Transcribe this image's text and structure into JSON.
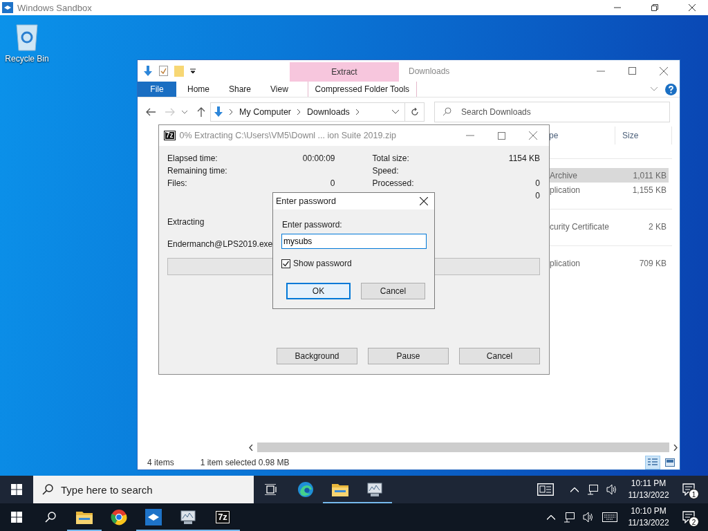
{
  "sandbox": {
    "title": "Windows Sandbox"
  },
  "desktop_icons": [
    {
      "label": "Recycle Bin"
    }
  ],
  "explorer": {
    "title": "Downloads",
    "context_group": "Extract",
    "ribbon_tabs": [
      {
        "label": "File",
        "kind": "file"
      },
      {
        "label": "Home",
        "kind": "tab"
      },
      {
        "label": "Share",
        "kind": "tab"
      },
      {
        "label": "View",
        "kind": "tab"
      },
      {
        "label": "Compressed Folder Tools",
        "kind": "context"
      }
    ],
    "breadcrumb": [
      "My Computer",
      "Downloads"
    ],
    "search": {
      "placeholder": "Search Downloads"
    },
    "columns": [
      "pe",
      "Size"
    ],
    "rows": [
      {
        "type": "Archive",
        "size": "1,011 KB",
        "selected": true
      },
      {
        "type": "plication",
        "size": "1,155 KB",
        "selected": false
      },
      {
        "type": "curity Certificate",
        "size": "2 KB",
        "selected": false
      },
      {
        "type": "plication",
        "size": "709 KB",
        "selected": false
      }
    ],
    "status": {
      "count": "4 items",
      "selection": "1 item selected  0.98 MB"
    }
  },
  "extract_window": {
    "app_icon": "7z",
    "title": "0% Extracting C:\\Users\\VM5\\Downl ... ion Suite 2019.zip",
    "stats_left": [
      {
        "label": "Elapsed time:",
        "value": "00:00:09"
      },
      {
        "label": "Remaining time:"
      },
      {
        "label": "Files:",
        "value": "0"
      }
    ],
    "stats_right": [
      {
        "label": "Total size:",
        "value": "1154 KB"
      },
      {
        "label": "Speed:"
      },
      {
        "label": "Processed:",
        "value": "0"
      },
      {
        "value": "0"
      }
    ],
    "operation": "Extracting",
    "current_file": "Endermanch@LPS2019.exe",
    "progress": {
      "level": 0
    },
    "buttons": [
      "Background",
      "Pause",
      "Cancel"
    ]
  },
  "password_dialog": {
    "title": "Enter password",
    "label": "Enter password:",
    "value": "mysubs",
    "show_password": {
      "label": "Show password",
      "checked": true
    },
    "buttons": [
      {
        "label": "OK",
        "default": true
      },
      {
        "label": "Cancel",
        "default": false
      }
    ]
  },
  "taskbars": [
    {
      "search": {
        "placeholder": "Type here to search"
      },
      "apps": [
        {
          "kind": "taskview",
          "active": false
        },
        {
          "kind": "edge",
          "active": false
        },
        {
          "kind": "folder",
          "active": true
        },
        {
          "kind": "monitor",
          "active": true
        }
      ],
      "tray": [
        {
          "kind": "news"
        },
        {
          "kind": "caret"
        },
        {
          "kind": "network"
        },
        {
          "kind": "volume"
        }
      ],
      "time": "10:11 PM",
      "date": "11/13/2022",
      "notifications": "1"
    },
    {
      "apps": [
        {
          "kind": "search",
          "active": false
        },
        {
          "kind": "folder",
          "active": true
        },
        {
          "kind": "chrome",
          "active": false
        },
        {
          "kind": "sandbox",
          "active": true
        },
        {
          "kind": "monitor",
          "active": true
        },
        {
          "kind": "sevenzip",
          "label": "7z",
          "active": true
        }
      ],
      "tray": [
        {
          "kind": "caret"
        },
        {
          "kind": "network"
        },
        {
          "kind": "volume"
        },
        {
          "kind": "keyboard"
        }
      ],
      "time": "10:10 PM",
      "date": "11/13/2022",
      "notifications": "2"
    }
  ]
}
